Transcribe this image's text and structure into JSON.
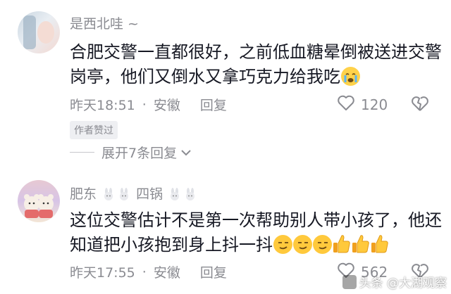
{
  "comments": [
    {
      "username": "是西北哇 ~",
      "text": "合肥交警一直都很好，之前低血糖晕倒被送进交警岗亭，他们又倒水又拿巧克力给我吃",
      "time": "昨天18:51",
      "location": "安徽",
      "reply_label": "回复",
      "like_count": "120",
      "author_badge": "作者赞过",
      "expand_label": "展开7条回复"
    },
    {
      "username_prefix": "肥东",
      "username_mid": "四锅",
      "text": "这位交警估计不是第一次帮助别人带小孩了，他还知道把小孩抱到身上抖一抖",
      "time": "昨天17:55",
      "location": "安徽",
      "reply_label": "回复",
      "like_count": "562"
    }
  ],
  "watermark": "头条 @大湖观察",
  "colors": {
    "text": "#161823",
    "meta": "#8a8b91",
    "emoji": "#ffd24a"
  }
}
